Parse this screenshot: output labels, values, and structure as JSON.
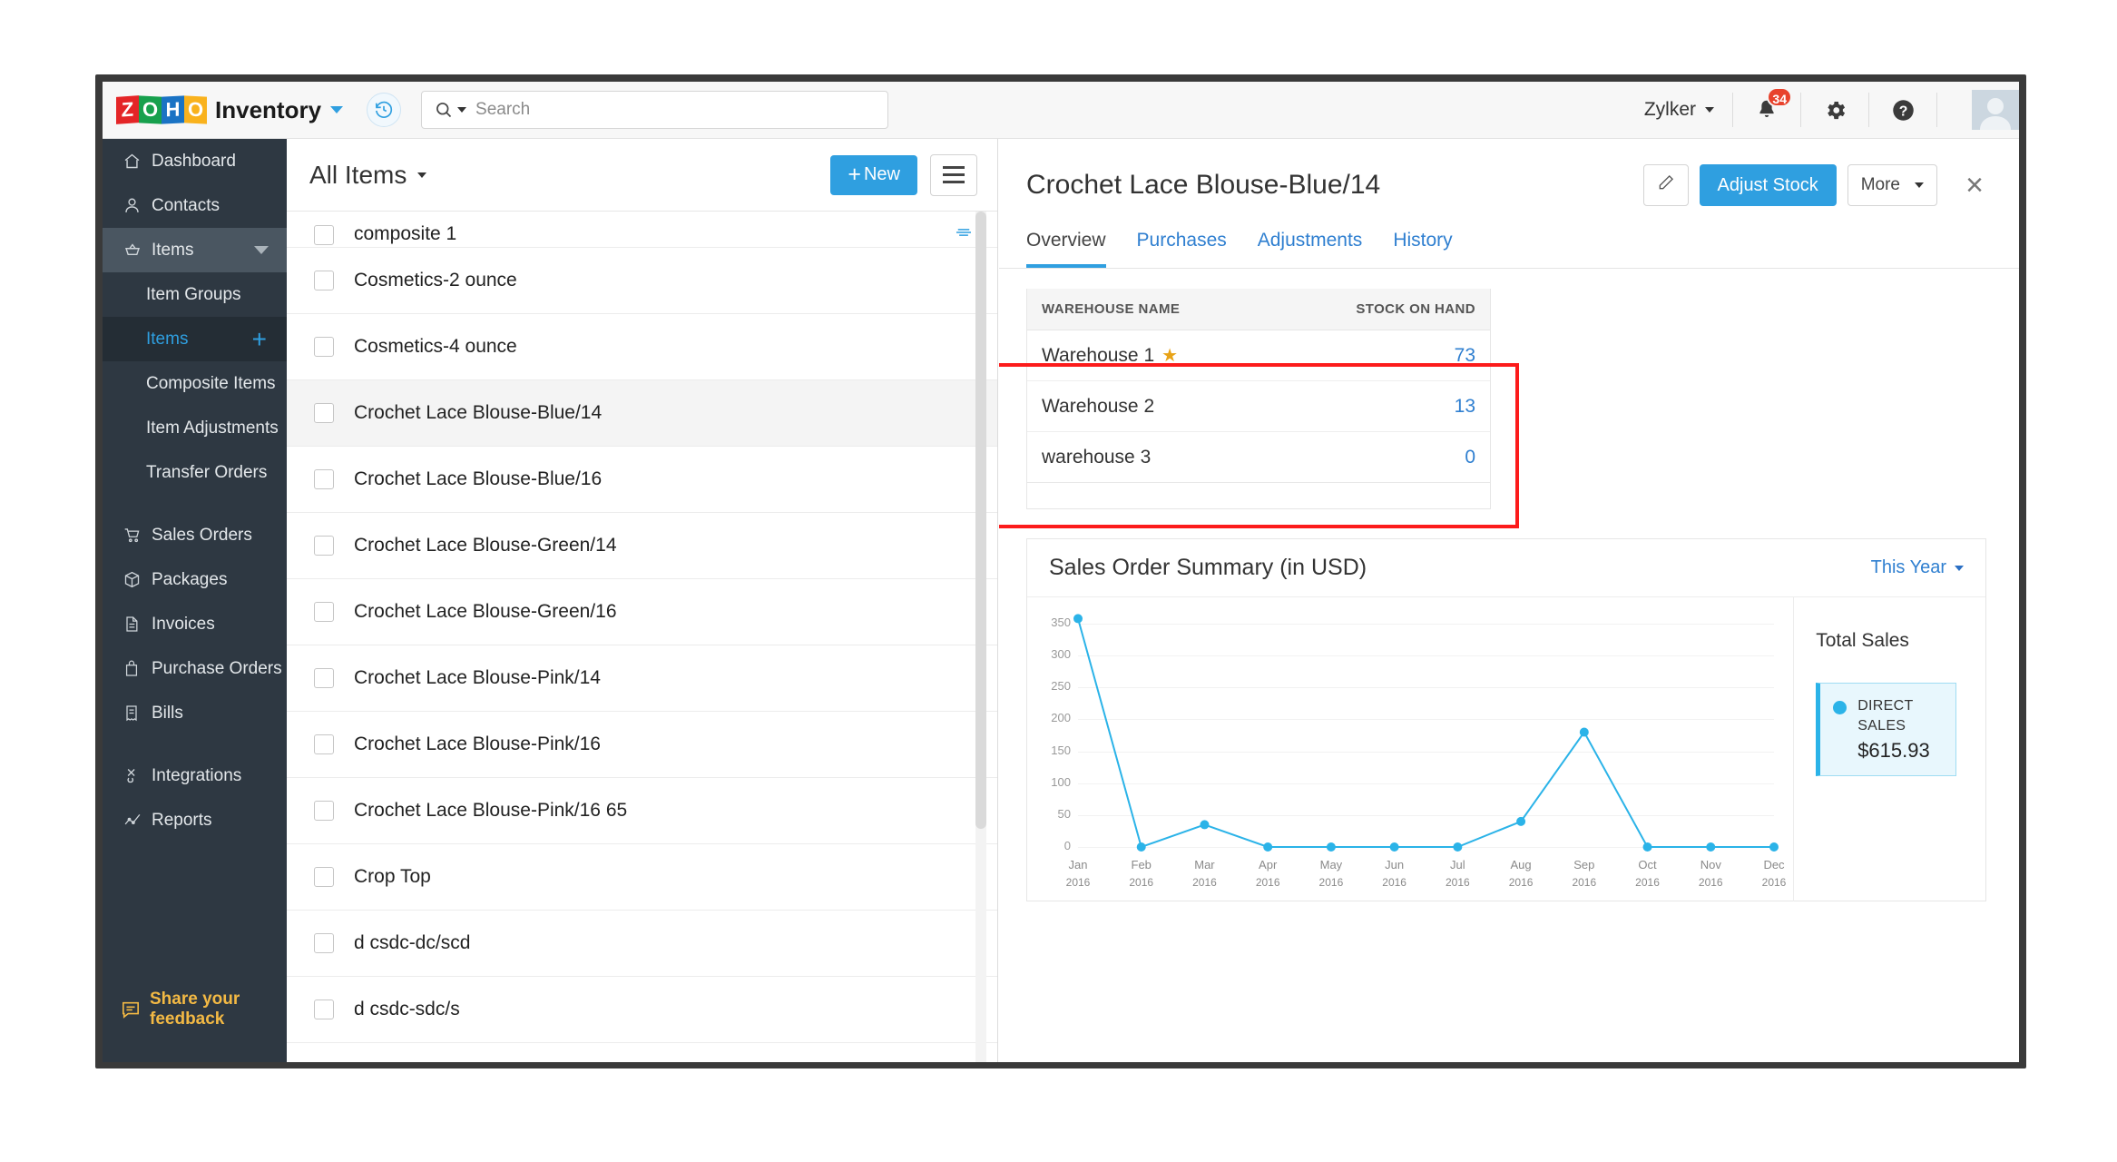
{
  "topbar": {
    "brand_letters": [
      "Z",
      "O",
      "H",
      "O"
    ],
    "app_name": "Inventory",
    "history_icon": "history-clock-icon",
    "search": {
      "placeholder": "Search",
      "value": "",
      "icon": "search-icon"
    },
    "org_name": "Zylker",
    "notification_count": "34",
    "icons": [
      "bell-icon",
      "gear-icon",
      "help-icon",
      "avatar"
    ]
  },
  "sidebar": {
    "items": [
      {
        "label": "Dashboard",
        "icon": "home-icon"
      },
      {
        "label": "Contacts",
        "icon": "person-icon"
      },
      {
        "label": "Items",
        "icon": "basket-icon",
        "expanded": true
      }
    ],
    "sub_items": [
      {
        "label": "Item Groups"
      },
      {
        "label": "Items",
        "active": true,
        "add": "+"
      },
      {
        "label": "Composite Items"
      },
      {
        "label": "Item Adjustments"
      },
      {
        "label": "Transfer Orders"
      }
    ],
    "items2": [
      {
        "label": "Sales Orders",
        "icon": "cart-icon"
      },
      {
        "label": "Packages",
        "icon": "box-icon"
      },
      {
        "label": "Invoices",
        "icon": "document-icon"
      },
      {
        "label": "Purchase Orders",
        "icon": "bag-icon"
      },
      {
        "label": "Bills",
        "icon": "receipt-icon"
      }
    ],
    "items3": [
      {
        "label": "Integrations",
        "icon": "plug-icon"
      },
      {
        "label": "Reports",
        "icon": "chart-line-icon"
      }
    ],
    "feedback": {
      "label": "Share your feedback",
      "icon": "speech-bubble-icon"
    }
  },
  "list_panel": {
    "title": "All Items",
    "new_button": "New",
    "menu_icon": "hamburger-icon",
    "rows": [
      {
        "label": "composite 1",
        "partial": true,
        "badge": "composite-icon"
      },
      {
        "label": "Cosmetics-2 ounce"
      },
      {
        "label": "Cosmetics-4 ounce"
      },
      {
        "label": "Crochet Lace Blouse-Blue/14",
        "selected": true
      },
      {
        "label": "Crochet Lace Blouse-Blue/16"
      },
      {
        "label": "Crochet Lace Blouse-Green/14"
      },
      {
        "label": "Crochet Lace Blouse-Green/16"
      },
      {
        "label": "Crochet Lace Blouse-Pink/14"
      },
      {
        "label": "Crochet Lace Blouse-Pink/16"
      },
      {
        "label": "Crochet Lace Blouse-Pink/16 65"
      },
      {
        "label": "Crop Top"
      },
      {
        "label": "d csdc-dc/scd"
      },
      {
        "label": "d csdc-sdc/s"
      }
    ]
  },
  "detail": {
    "title": "Crochet Lace Blouse-Blue/14",
    "edit_icon": "pencil-icon",
    "adjust_stock_label": "Adjust Stock",
    "more_label": "More",
    "close_icon": "close-icon",
    "tabs": [
      {
        "label": "Overview",
        "active": true
      },
      {
        "label": "Purchases"
      },
      {
        "label": "Adjustments"
      },
      {
        "label": "History"
      }
    ],
    "warehouse_table": {
      "headers": [
        "WAREHOUSE NAME",
        "STOCK ON HAND"
      ],
      "rows": [
        {
          "name": "Warehouse 1",
          "primary": true,
          "star": "★",
          "stock": "73"
        },
        {
          "name": "Warehouse 2",
          "primary": false,
          "stock": "13"
        },
        {
          "name": "warehouse 3",
          "primary": false,
          "stock": "0"
        }
      ]
    },
    "sales_summary": {
      "title": "Sales Order Summary (in USD)",
      "period": "This Year",
      "legend_title": "Total Sales",
      "legend_label": "DIRECT SALES",
      "legend_amount": "$615.93",
      "accent_color": "#2bb3e8"
    }
  },
  "chart_data": {
    "type": "line",
    "title": "Sales Order Summary (in USD)",
    "xlabel": "",
    "ylabel": "",
    "ylim": [
      0,
      360
    ],
    "yticks": [
      0,
      50,
      100,
      150,
      200,
      250,
      300,
      350
    ],
    "grid": true,
    "legend_position": "right",
    "categories": [
      "Jan",
      "Feb",
      "Mar",
      "Apr",
      "May",
      "Jun",
      "Jul",
      "Aug",
      "Sep",
      "Oct",
      "Nov",
      "Dec"
    ],
    "category_year": "2016",
    "series": [
      {
        "name": "DIRECT SALES",
        "color": "#2bb3e8",
        "values": [
          358,
          0,
          35,
          0,
          0,
          0,
          0,
          40,
          180,
          0,
          0,
          0
        ]
      }
    ]
  }
}
